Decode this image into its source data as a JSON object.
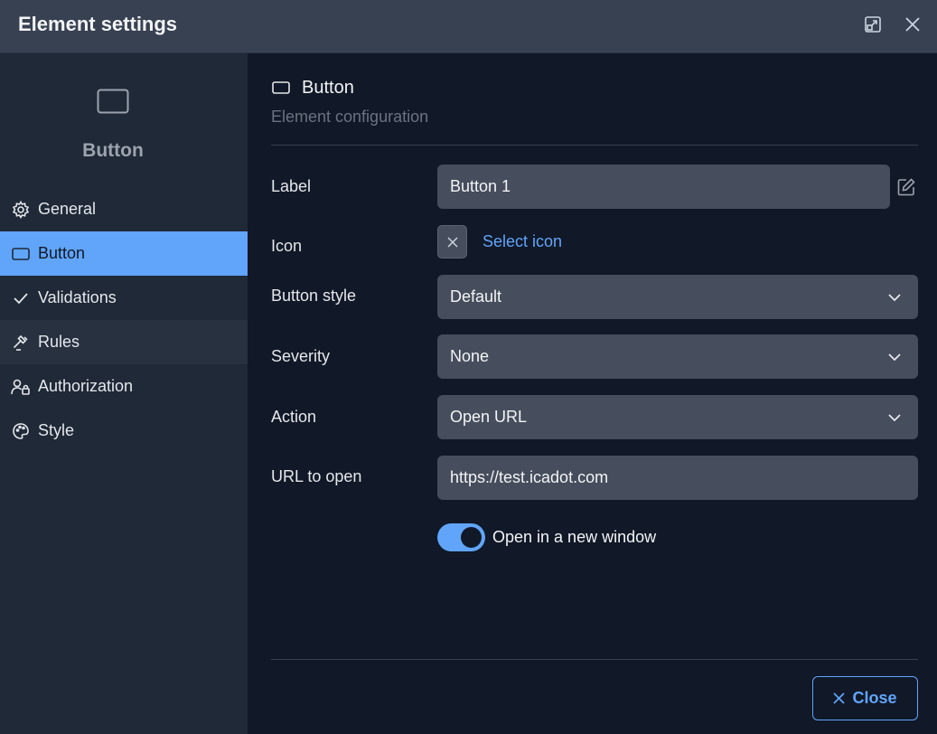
{
  "window": {
    "title": "Element settings",
    "expand_icon": "expand-icon",
    "close_icon": "close-icon"
  },
  "sidebar": {
    "header_icon": "button-rectangle-icon",
    "header_label": "Button",
    "items": [
      {
        "label": "General",
        "icon": "gear-icon",
        "state": "normal"
      },
      {
        "label": "Button",
        "icon": "button-rectangle-icon",
        "state": "active"
      },
      {
        "label": "Validations",
        "icon": "check-icon",
        "state": "normal"
      },
      {
        "label": "Rules",
        "icon": "hammer-icon",
        "state": "hover"
      },
      {
        "label": "Authorization",
        "icon": "user-lock-icon",
        "state": "normal"
      },
      {
        "label": "Style",
        "icon": "palette-icon",
        "state": "normal"
      }
    ]
  },
  "main": {
    "section_title": "Button",
    "section_subtitle": "Element configuration",
    "fields": {
      "label": {
        "label": "Label",
        "value": "Button 1"
      },
      "icon": {
        "label": "Icon",
        "link": "Select icon"
      },
      "button_style": {
        "label": "Button style",
        "value": "Default"
      },
      "severity": {
        "label": "Severity",
        "value": "None"
      },
      "action": {
        "label": "Action",
        "value": "Open URL"
      },
      "url": {
        "label": "URL to open",
        "value": "https://test.icadot.com"
      }
    },
    "toggle": {
      "label": "Open in a new window",
      "on": true
    }
  },
  "footer": {
    "close_label": "Close"
  },
  "colors": {
    "accent": "#60a5fa",
    "background": "#111827",
    "sidebar": "#1f2937",
    "titlebar": "#374151",
    "input": "#464d5c"
  }
}
